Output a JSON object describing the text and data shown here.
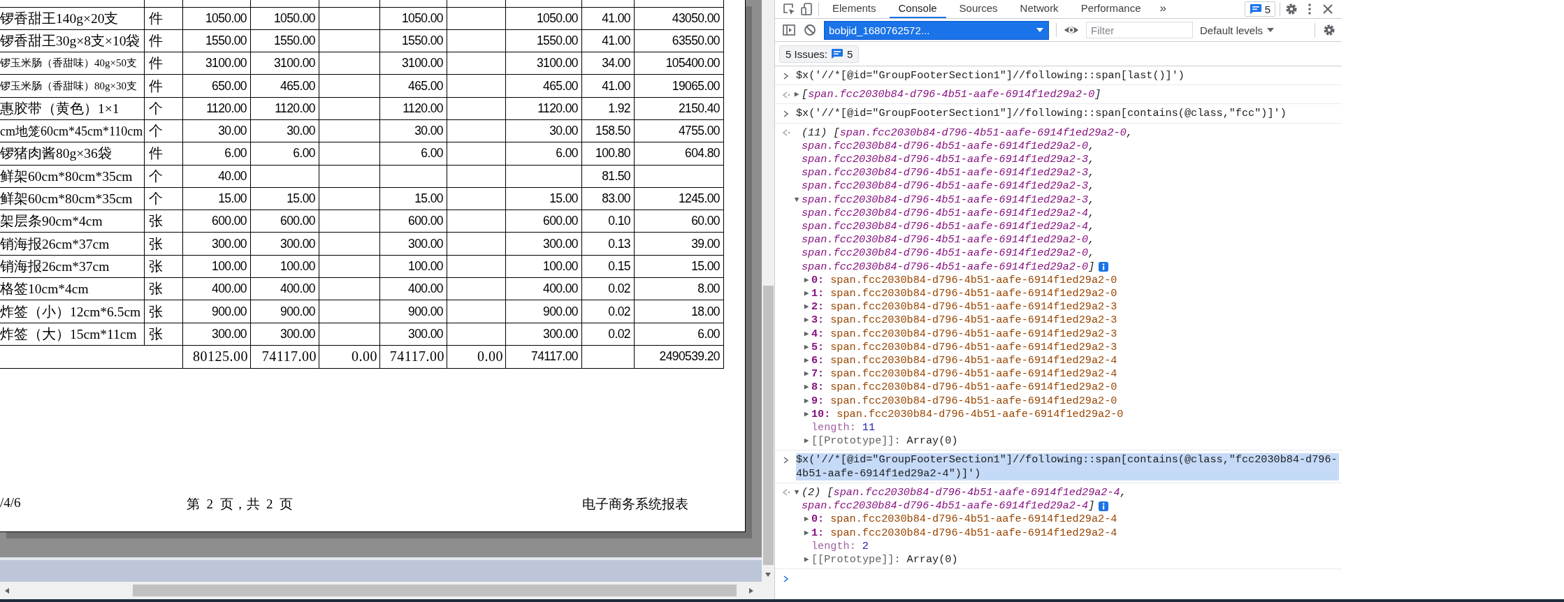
{
  "report": {
    "rows": [
      {
        "name": "锣香甜王140g×20支",
        "unit": "件",
        "column_3": "1050.00",
        "column_4": "1050.00",
        "column_6": "1050.00",
        "column_8": "1050.00",
        "column_9": "41.00",
        "column_10": "43050.00"
      },
      {
        "name": "锣香甜王30g×8支×10袋",
        "unit": "件",
        "column_3": "1550.00",
        "column_4": "1550.00",
        "column_6": "1550.00",
        "column_8": "1550.00",
        "column_9": "41.00",
        "column_10": "63550.00"
      },
      {
        "name": "锣玉米肠（香甜味）40g×50支",
        "unit": "件",
        "column_3": "3100.00",
        "column_4": "3100.00",
        "column_6": "3100.00",
        "column_8": "3100.00",
        "column_9": "34.00",
        "column_10": "105400.00"
      },
      {
        "name": "锣玉米肠（香甜味）80g×30支",
        "unit": "件",
        "column_3": "650.00",
        "column_4": "465.00",
        "column_6": "465.00",
        "column_8": "465.00",
        "column_9": "41.00",
        "column_10": "19065.00"
      },
      {
        "name": "惠胶带（黄色）1×1",
        "unit": "个",
        "column_3": "1120.00",
        "column_4": "1120.00",
        "column_6": "1120.00",
        "column_8": "1120.00",
        "column_9": "1.92",
        "column_10": "2150.40"
      },
      {
        "name": "cm地笼60cm*45cm*110cm",
        "unit": "个",
        "column_3": "30.00",
        "column_4": "30.00",
        "column_6": "30.00",
        "column_8": "30.00",
        "column_9": "158.50",
        "column_10": "4755.00"
      },
      {
        "name": "锣猪肉酱80g×36袋",
        "unit": "件",
        "column_3": "6.00",
        "column_4": "6.00",
        "column_6": "6.00",
        "column_8": "6.00",
        "column_9": "100.80",
        "column_10": "604.80"
      },
      {
        "name": "鲜架60cm*80cm*35cm",
        "unit": "个",
        "column_3": "40.00",
        "column_9": "81.50"
      },
      {
        "name": "鲜架60cm*80cm*35cm",
        "unit": "个",
        "column_3": "15.00",
        "column_4": "15.00",
        "column_6": "15.00",
        "column_8": "15.00",
        "column_9": "83.00",
        "column_10": "1245.00"
      },
      {
        "name": "架层条90cm*4cm",
        "unit": "张",
        "column_3": "600.00",
        "column_4": "600.00",
        "column_6": "600.00",
        "column_8": "600.00",
        "column_9": "0.10",
        "column_10": "60.00"
      },
      {
        "name": "销海报26cm*37cm",
        "unit": "张",
        "column_3": "300.00",
        "column_4": "300.00",
        "column_6": "300.00",
        "column_8": "300.00",
        "column_9": "0.13",
        "column_10": "39.00"
      },
      {
        "name": "销海报26cm*37cm",
        "unit": "张",
        "column_3": "100.00",
        "column_4": "100.00",
        "column_6": "100.00",
        "column_8": "100.00",
        "column_9": "0.15",
        "column_10": "15.00"
      },
      {
        "name": "格签10cm*4cm",
        "unit": "张",
        "column_3": "400.00",
        "column_4": "400.00",
        "column_6": "400.00",
        "column_8": "400.00",
        "column_9": "0.02",
        "column_10": "8.00"
      },
      {
        "name": "炸签（小）12cm*6.5cm",
        "unit": "张",
        "column_3": "900.00",
        "column_4": "900.00",
        "column_6": "900.00",
        "column_8": "900.00",
        "column_9": "0.02",
        "column_10": "18.00"
      },
      {
        "name": "炸签（大）15cm*11cm",
        "unit": "张",
        "column_3": "300.00",
        "column_4": "300.00",
        "column_6": "300.00",
        "column_8": "300.00",
        "column_9": "0.02",
        "column_10": "6.00"
      }
    ],
    "totals": {
      "column_3": {
        "text": "80125.00",
        "kind": "serif"
      },
      "column_4": {
        "text": "74117.00",
        "kind": "serif"
      },
      "column_5": {
        "text": "0.00",
        "kind": "serif"
      },
      "column_6": {
        "text": "74117.00",
        "kind": "serif"
      },
      "column_7": {
        "text": "0.00",
        "kind": "serif"
      },
      "column_8": {
        "text": "74117.00",
        "kind": "sans"
      },
      "column_10": {
        "text": "2490539.20",
        "kind": "sans"
      }
    },
    "footer": {
      "left": "/4/6",
      "center": "第  2  页，共  2  页",
      "right": "电子商务系统报表"
    }
  },
  "devtools": {
    "tabs": [
      {
        "label": "Elements",
        "selected": false
      },
      {
        "label": "Console",
        "selected": true
      },
      {
        "label": "Sources",
        "selected": false
      },
      {
        "label": "Network",
        "selected": false
      },
      {
        "label": "Performance",
        "selected": false
      }
    ],
    "more_tabs": "»",
    "issues_badge": "5",
    "context": "bobjid_1680762572...",
    "filter": {
      "placeholder": "Filter"
    },
    "levels": "Default levels",
    "issues_button": {
      "label": "5 Issues:",
      "count": "5"
    },
    "console": [
      {
        "kind": "input",
        "selected": false,
        "text": "$x('//*[@id=\"GroupFooterSection1\"]//following::span[last()]')"
      },
      {
        "kind": "result",
        "lines": [
          {
            "toggle": "▶",
            "before": "[",
            "node": "span.fcc2030b84-d796-4b51-aafe-6914f1ed29a2-0",
            "after": "]",
            "info": false
          }
        ]
      },
      {
        "kind": "input",
        "selected": false,
        "text": "$x('//*[@id=\"GroupFooterSection1\"]//following::span[contains(@class,\"fcc\")]')"
      },
      {
        "kind": "result",
        "lines": [
          {
            "before": "(11) [",
            "node": "span.fcc2030b84-d796-4b51-aafe-6914f1ed29a2-0",
            "after": ",",
            "info": false
          },
          {
            "node": "span.fcc2030b84-d796-4b51-aafe-6914f1ed29a2-0",
            "after": ",",
            "info": false
          },
          {
            "node": "span.fcc2030b84-d796-4b51-aafe-6914f1ed29a2-3",
            "after": ",",
            "info": false
          },
          {
            "node": "span.fcc2030b84-d796-4b51-aafe-6914f1ed29a2-3",
            "after": ",",
            "info": false
          },
          {
            "node": "span.fcc2030b84-d796-4b51-aafe-6914f1ed29a2-3",
            "after": ",",
            "info": false
          },
          {
            "toggle": "▼",
            "node": "span.fcc2030b84-d796-4b51-aafe-6914f1ed29a2-3",
            "after": ",",
            "info": false
          },
          {
            "node": "span.fcc2030b84-d796-4b51-aafe-6914f1ed29a2-4",
            "after": ",",
            "info": false
          },
          {
            "node": "span.fcc2030b84-d796-4b51-aafe-6914f1ed29a2-4",
            "after": ",",
            "info": false
          },
          {
            "node": "span.fcc2030b84-d796-4b51-aafe-6914f1ed29a2-0",
            "after": ",",
            "info": false
          },
          {
            "node": "span.fcc2030b84-d796-4b51-aafe-6914f1ed29a2-0",
            "after": ",",
            "info": false
          },
          {
            "node": "span.fcc2030b84-d796-4b51-aafe-6914f1ed29a2-0",
            "after": "]",
            "info": true
          }
        ],
        "props": [
          {
            "kind": "node",
            "toggle": "▶",
            "key": "0:",
            "value": "span.fcc2030b84-d796-4b51-aafe-6914f1ed29a2-0"
          },
          {
            "kind": "node",
            "toggle": "▶",
            "key": "1:",
            "value": "span.fcc2030b84-d796-4b51-aafe-6914f1ed29a2-0"
          },
          {
            "kind": "node",
            "toggle": "▶",
            "key": "2:",
            "value": "span.fcc2030b84-d796-4b51-aafe-6914f1ed29a2-3"
          },
          {
            "kind": "node",
            "toggle": "▶",
            "key": "3:",
            "value": "span.fcc2030b84-d796-4b51-aafe-6914f1ed29a2-3"
          },
          {
            "kind": "node",
            "toggle": "▶",
            "key": "4:",
            "value": "span.fcc2030b84-d796-4b51-aafe-6914f1ed29a2-3"
          },
          {
            "kind": "node",
            "toggle": "▶",
            "key": "5:",
            "value": "span.fcc2030b84-d796-4b51-aafe-6914f1ed29a2-3"
          },
          {
            "kind": "node",
            "toggle": "▶",
            "key": "6:",
            "value": "span.fcc2030b84-d796-4b51-aafe-6914f1ed29a2-4"
          },
          {
            "kind": "node",
            "toggle": "▶",
            "key": "7:",
            "value": "span.fcc2030b84-d796-4b51-aafe-6914f1ed29a2-4"
          },
          {
            "kind": "node",
            "toggle": "▶",
            "key": "8:",
            "value": "span.fcc2030b84-d796-4b51-aafe-6914f1ed29a2-0"
          },
          {
            "kind": "node",
            "toggle": "▶",
            "key": "9:",
            "value": "span.fcc2030b84-d796-4b51-aafe-6914f1ed29a2-0"
          },
          {
            "kind": "node",
            "toggle": "▶",
            "key": "10:",
            "value": "span.fcc2030b84-d796-4b51-aafe-6914f1ed29a2-0"
          },
          {
            "kind": "length",
            "key": "length:",
            "value": "11"
          },
          {
            "kind": "proto",
            "toggle": "▶",
            "key": "[[Prototype]]:",
            "value": "Array(0)"
          }
        ]
      },
      {
        "kind": "input",
        "selected": true,
        "text": "$x('//*[@id=\"GroupFooterSection1\"]//following::span[contains(@class,\"fcc2030b84-d796-4b51-aafe-6914f1ed29a2-4\")]')"
      },
      {
        "kind": "result",
        "lines": [
          {
            "toggle": "▼",
            "before": "(2) [",
            "node": "span.fcc2030b84-d796-4b51-aafe-6914f1ed29a2-4",
            "after": ",",
            "info": false
          },
          {
            "node": "span.fcc2030b84-d796-4b51-aafe-6914f1ed29a2-4",
            "after": "]",
            "info": true
          }
        ],
        "props": [
          {
            "kind": "node",
            "toggle": "▶",
            "key": "0:",
            "value": "span.fcc2030b84-d796-4b51-aafe-6914f1ed29a2-4"
          },
          {
            "kind": "node",
            "toggle": "▶",
            "key": "1:",
            "value": "span.fcc2030b84-d796-4b51-aafe-6914f1ed29a2-4"
          },
          {
            "kind": "length",
            "key": "length:",
            "value": "2"
          },
          {
            "kind": "proto",
            "toggle": "▶",
            "key": "[[Prototype]]:",
            "value": "Array(0)"
          }
        ]
      },
      {
        "kind": "prompt"
      }
    ]
  }
}
